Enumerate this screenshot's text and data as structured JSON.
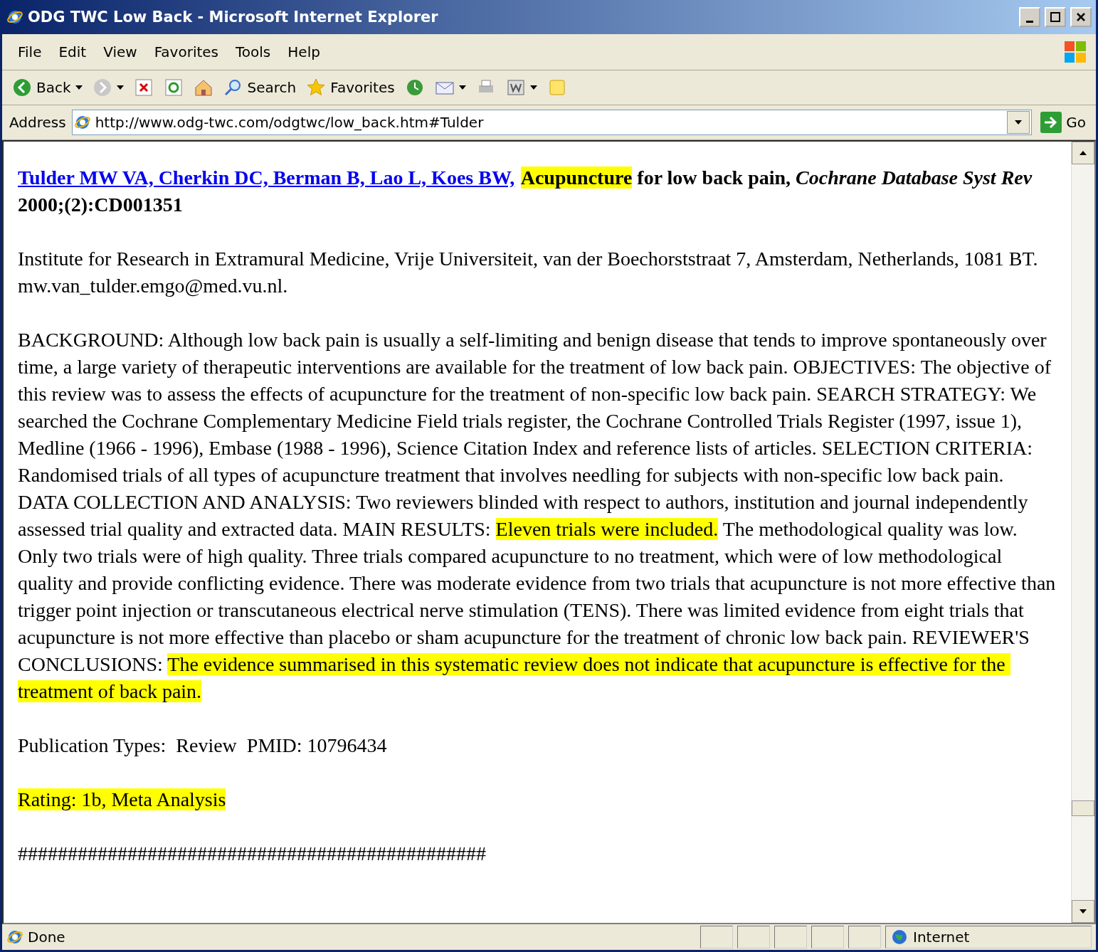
{
  "window": {
    "title": "ODG TWC Low Back - Microsoft Internet Explorer"
  },
  "menu": [
    "File",
    "Edit",
    "View",
    "Favorites",
    "Tools",
    "Help"
  ],
  "toolbar": [
    {
      "kind": "back",
      "label": "Back"
    },
    {
      "kind": "forward"
    },
    {
      "kind": "stop"
    },
    {
      "kind": "refresh"
    },
    {
      "kind": "home"
    },
    {
      "kind": "search",
      "label": "Search"
    },
    {
      "kind": "favorites",
      "label": "Favorites"
    },
    {
      "kind": "history"
    },
    {
      "kind": "mail"
    },
    {
      "kind": "print"
    },
    {
      "kind": "edit"
    },
    {
      "kind": "note"
    }
  ],
  "address": {
    "label": "Address",
    "value": "http://www.odg-twc.com/odgtwc/low_back.htm#Tulder",
    "go": "Go"
  },
  "paragraphs": [
    {
      "bold": true,
      "segments": [
        {
          "kind": "link",
          "text": "Tulder MW VA, Cherkin DC, Berman B, Lao L, Koes BW,",
          "highlight": false
        },
        {
          "kind": "text",
          "text": "Acupuncture",
          "highlight": true
        },
        {
          "kind": "text",
          "text": " for low back pain, *Cochrane Database Syst Rev* 2000;(2):CD001351",
          "highlight": false
        }
      ]
    },
    {
      "bold": false,
      "segments": [
        {
          "kind": "text",
          "text": "Institute for Research in Extramural Medicine, Vrije Universiteit, van der Boechorststraat 7, Amsterdam, Netherlands, 1081 BT. mw.van_tulder.emgo@med.vu.nl.",
          "highlight": false
        }
      ]
    },
    {
      "bold": false,
      "segments": [
        {
          "kind": "text",
          "text": "BACKGROUND: Although low back pain is usually a self-limiting and benign disease that tends to improve spontaneously over time, a large variety of therapeutic interventions are available for the treatment of low back pain. OBJECTIVES: The objective of this review was to assess the effects of acupuncture for the treatment of non-specific low back pain. SEARCH STRATEGY: We searched the Cochrane Complementary Medicine Field trials register, the Cochrane Controlled Trials Register (1997, issue 1), Medline (1966 - 1996), Embase (1988 - 1996), Science Citation Index and reference lists of articles. SELECTION CRITERIA: Randomised trials of all types of acupuncture treatment that involves needling for subjects with non-specific low back pain. DATA COLLECTION AND ANALYSIS: Two reviewers blinded with respect to authors, institution and journal independently assessed trial quality and extracted data. MAIN RESULTS: ",
          "highlight": false
        },
        {
          "kind": "text",
          "text": "Eleven trials were included.",
          "highlight": true
        },
        {
          "kind": "text",
          "text": " The methodological quality was low. Only two trials were of high quality. Three trials compared acupuncture to no treatment, which were of low methodological quality and provide conflicting evidence. There was moderate evidence from two trials that acupuncture is not more effective than trigger point injection or transcutaneous electrical nerve stimulation (TENS). There was limited evidence from eight trials that acupuncture is not more effective than placebo or sham acupuncture for the treatment of chronic low back pain. REVIEWER'S CONCLUSIONS: ",
          "highlight": false
        },
        {
          "kind": "text",
          "text": "The evidence summarised in this systematic review does not indicate that acupuncture is effective for the treatment of back pain.",
          "highlight": true
        }
      ]
    },
    {
      "bold": false,
      "segments": [
        {
          "kind": "text",
          "text": "Publication Types:  Review  PMID: 10796434",
          "highlight": false
        }
      ]
    },
    {
      "bold": false,
      "segments": [
        {
          "kind": "text",
          "text": "Rating: 1b, Meta Analysis",
          "highlight": true
        }
      ]
    },
    {
      "bold": false,
      "segments": [
        {
          "kind": "text",
          "text": "###############################################",
          "highlight": false
        }
      ]
    }
  ],
  "status_bar": {
    "text": "Done",
    "zone": "Internet"
  }
}
